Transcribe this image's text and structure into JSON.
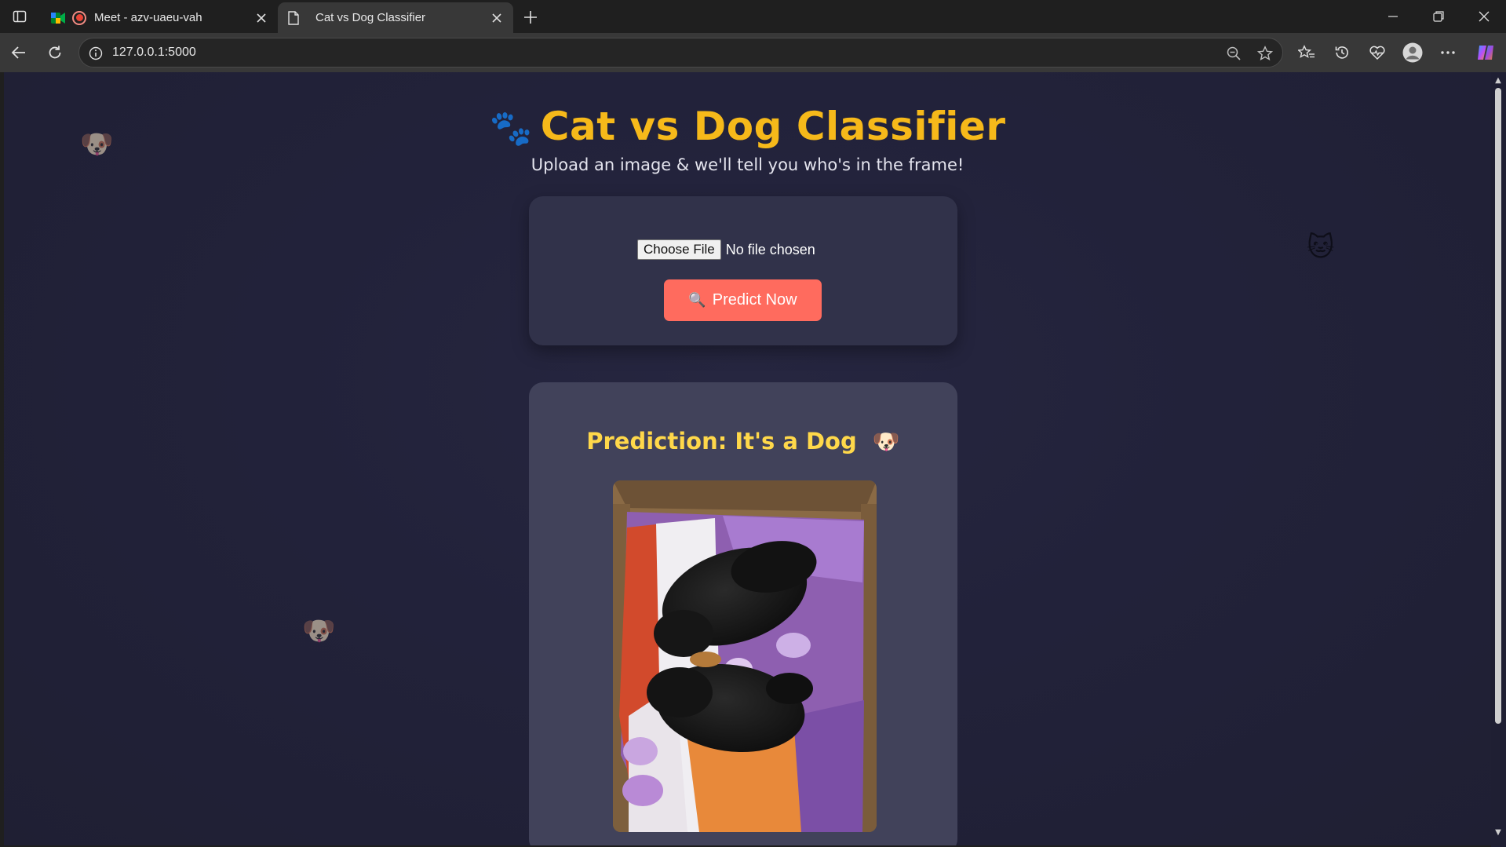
{
  "browser": {
    "tabs": [
      {
        "title": "Meet - azv-uaeu-vah",
        "active": false
      },
      {
        "title": "Cat vs Dog Classifier",
        "active": true
      }
    ],
    "url": "127.0.0.1:5000"
  },
  "page": {
    "title": "Cat vs Dog Classifier",
    "title_emoji": "🐾",
    "subtitle": "Upload an image & we'll tell you who's in the frame!",
    "choose_file_label": "Choose File",
    "no_file_text": "No file chosen",
    "predict_icon": "🔍",
    "predict_label": "Predict Now",
    "prediction_text": "Prediction: It's a Dog",
    "prediction_emoji": "🐶",
    "floaters": [
      "🐶",
      "🐱",
      "🐶"
    ]
  },
  "colors": {
    "accent_title": "#f6b91a",
    "prediction": "#ffd84a",
    "button": "#ff6b5e"
  }
}
